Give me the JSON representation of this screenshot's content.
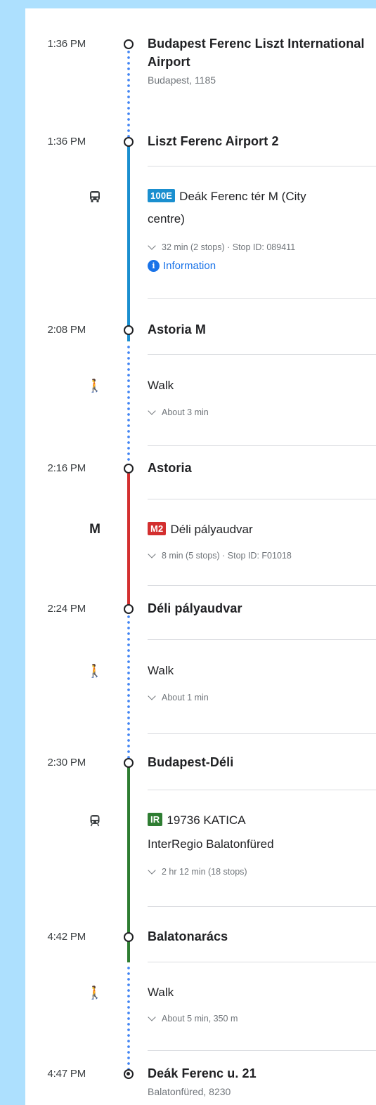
{
  "colors": {
    "walk_dots": "#4285f4",
    "bus_line": "#1a8fcf",
    "metro_line": "#d32f2f",
    "train_line": "#2e7d32"
  },
  "stops": {
    "s1": {
      "time": "1:36 PM",
      "name_line1": "Budapest Ferenc Liszt International",
      "name_line2": "Airport",
      "address": "Budapest, 1185"
    },
    "s2": {
      "time": "1:36 PM",
      "name": "Liszt Ferenc Airport 2"
    },
    "s3": {
      "time": "2:08 PM",
      "name": "Astoria M"
    },
    "s4": {
      "time": "2:16 PM",
      "name": "Astoria"
    },
    "s5": {
      "time": "2:24 PM",
      "name": "Déli pályaudvar"
    },
    "s6": {
      "time": "2:30 PM",
      "name": "Budapest-Déli"
    },
    "s7": {
      "time": "4:42 PM",
      "name": "Balatonarács"
    },
    "s8": {
      "time": "4:47 PM",
      "name": "Deák Ferenc u. 21",
      "address": "Balatonfüred, 8230"
    }
  },
  "legs": {
    "bus": {
      "icon": "bus-icon",
      "badge": "100E",
      "badge_color": "#1a8fcf",
      "headsign_line1": "Deák Ferenc tér M (City",
      "headsign_line2": "centre)",
      "detail": "32 min (2 stops) · Stop ID: 089411",
      "info_label": "Information"
    },
    "walk1": {
      "icon": "walk-icon",
      "label": "Walk",
      "detail": "About 3 min"
    },
    "metro": {
      "icon": "metro-icon",
      "badge": "M2",
      "badge_color": "#d32f2f",
      "headsign": "Déli pályaudvar",
      "detail": "8 min (5 stops) · Stop ID: F01018"
    },
    "walk2": {
      "icon": "walk-icon",
      "label": "Walk",
      "detail": "About 1 min"
    },
    "train": {
      "icon": "train-icon",
      "badge": "IR",
      "badge_color": "#2e7d32",
      "headsign_line1": "19736 KATICA",
      "headsign_line2": "InterRegio Balatonfüred",
      "detail": "2 hr 12 min (18 stops)"
    },
    "walk3": {
      "icon": "walk-icon",
      "label": "Walk",
      "detail": "About 5 min, 350 m"
    }
  }
}
